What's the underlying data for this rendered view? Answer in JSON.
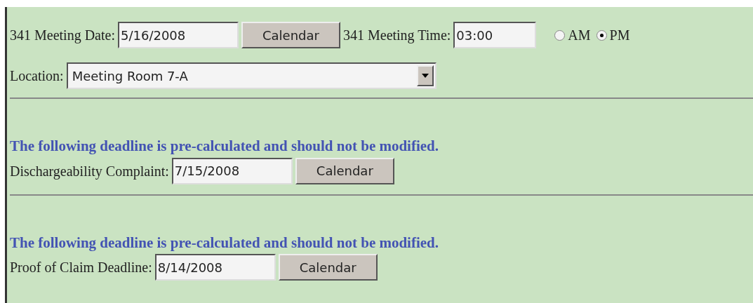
{
  "meeting": {
    "date_label": "341 Meeting Date:",
    "date_value": "5/16/2008",
    "date_button": "Calendar",
    "time_label": "341 Meeting Time:",
    "time_value": "03:00",
    "period_options": [
      {
        "label": "AM",
        "selected": false
      },
      {
        "label": "PM",
        "selected": true
      }
    ],
    "location_label": "Location:",
    "location_value": "Meeting Room 7-A"
  },
  "deadlines": [
    {
      "notice": "The following deadline is pre-calculated and should not be modified.",
      "label": "Dischargeability Complaint:",
      "value": "7/15/2008",
      "button": "Calendar"
    },
    {
      "notice": "The following deadline is pre-calculated and should not be modified.",
      "label": "Proof of Claim Deadline:",
      "value": "8/14/2008",
      "button": "Calendar"
    }
  ]
}
